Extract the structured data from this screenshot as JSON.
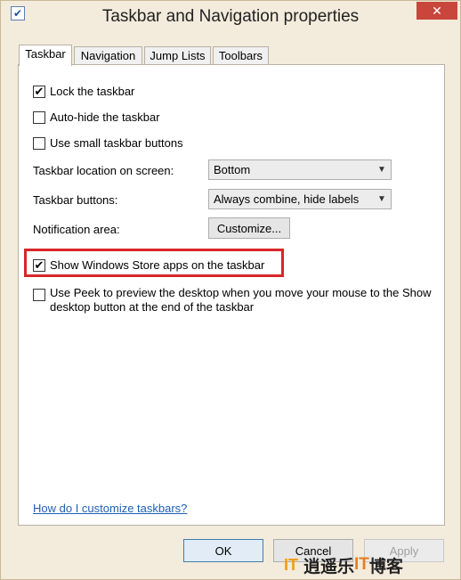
{
  "window": {
    "title": "Taskbar and Navigation properties",
    "close_label": "✕"
  },
  "tabs": [
    {
      "label": "Taskbar",
      "active": true
    },
    {
      "label": "Navigation",
      "active": false
    },
    {
      "label": "Jump Lists",
      "active": false
    },
    {
      "label": "Toolbars",
      "active": false
    }
  ],
  "options": {
    "lock_taskbar": {
      "label": "Lock the taskbar",
      "checked": true
    },
    "auto_hide": {
      "label": "Auto-hide the taskbar",
      "checked": false
    },
    "small_buttons": {
      "label": "Use small taskbar buttons",
      "checked": false
    }
  },
  "settings": {
    "location_label": "Taskbar location on screen:",
    "location_value": "Bottom",
    "buttons_label": "Taskbar buttons:",
    "buttons_value": "Always combine, hide labels",
    "notification_label": "Notification area:",
    "customize_label": "Customize..."
  },
  "store_apps": {
    "label": "Show Windows Store apps on the taskbar",
    "checked": true
  },
  "peek": {
    "label": "Use Peek to preview the desktop when you move your mouse to the Show desktop button at the end of the taskbar",
    "checked": false
  },
  "help_link": "How do I customize taskbars?",
  "footer": {
    "ok_label": "OK",
    "cancel_label": "Cancel",
    "apply_label": "Apply"
  },
  "watermark": {
    "logo": "IT",
    "text_a": "逍遥乐",
    "text_b": "IT",
    "text_c": "博客"
  },
  "colors": {
    "highlight": "#d9262a",
    "link": "#1f5fb5"
  }
}
